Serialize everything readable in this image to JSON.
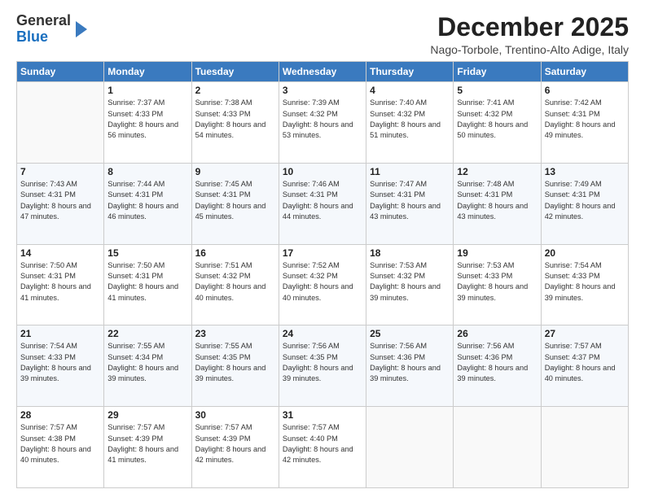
{
  "logo": {
    "general": "General",
    "blue": "Blue"
  },
  "header": {
    "month": "December 2025",
    "location": "Nago-Torbole, Trentino-Alto Adige, Italy"
  },
  "days_of_week": [
    "Sunday",
    "Monday",
    "Tuesday",
    "Wednesday",
    "Thursday",
    "Friday",
    "Saturday"
  ],
  "weeks": [
    [
      {
        "day": "",
        "sunrise": "",
        "sunset": "",
        "daylight": ""
      },
      {
        "day": "1",
        "sunrise": "Sunrise: 7:37 AM",
        "sunset": "Sunset: 4:33 PM",
        "daylight": "Daylight: 8 hours and 56 minutes."
      },
      {
        "day": "2",
        "sunrise": "Sunrise: 7:38 AM",
        "sunset": "Sunset: 4:33 PM",
        "daylight": "Daylight: 8 hours and 54 minutes."
      },
      {
        "day": "3",
        "sunrise": "Sunrise: 7:39 AM",
        "sunset": "Sunset: 4:32 PM",
        "daylight": "Daylight: 8 hours and 53 minutes."
      },
      {
        "day": "4",
        "sunrise": "Sunrise: 7:40 AM",
        "sunset": "Sunset: 4:32 PM",
        "daylight": "Daylight: 8 hours and 51 minutes."
      },
      {
        "day": "5",
        "sunrise": "Sunrise: 7:41 AM",
        "sunset": "Sunset: 4:32 PM",
        "daylight": "Daylight: 8 hours and 50 minutes."
      },
      {
        "day": "6",
        "sunrise": "Sunrise: 7:42 AM",
        "sunset": "Sunset: 4:31 PM",
        "daylight": "Daylight: 8 hours and 49 minutes."
      }
    ],
    [
      {
        "day": "7",
        "sunrise": "Sunrise: 7:43 AM",
        "sunset": "Sunset: 4:31 PM",
        "daylight": "Daylight: 8 hours and 47 minutes."
      },
      {
        "day": "8",
        "sunrise": "Sunrise: 7:44 AM",
        "sunset": "Sunset: 4:31 PM",
        "daylight": "Daylight: 8 hours and 46 minutes."
      },
      {
        "day": "9",
        "sunrise": "Sunrise: 7:45 AM",
        "sunset": "Sunset: 4:31 PM",
        "daylight": "Daylight: 8 hours and 45 minutes."
      },
      {
        "day": "10",
        "sunrise": "Sunrise: 7:46 AM",
        "sunset": "Sunset: 4:31 PM",
        "daylight": "Daylight: 8 hours and 44 minutes."
      },
      {
        "day": "11",
        "sunrise": "Sunrise: 7:47 AM",
        "sunset": "Sunset: 4:31 PM",
        "daylight": "Daylight: 8 hours and 43 minutes."
      },
      {
        "day": "12",
        "sunrise": "Sunrise: 7:48 AM",
        "sunset": "Sunset: 4:31 PM",
        "daylight": "Daylight: 8 hours and 43 minutes."
      },
      {
        "day": "13",
        "sunrise": "Sunrise: 7:49 AM",
        "sunset": "Sunset: 4:31 PM",
        "daylight": "Daylight: 8 hours and 42 minutes."
      }
    ],
    [
      {
        "day": "14",
        "sunrise": "Sunrise: 7:50 AM",
        "sunset": "Sunset: 4:31 PM",
        "daylight": "Daylight: 8 hours and 41 minutes."
      },
      {
        "day": "15",
        "sunrise": "Sunrise: 7:50 AM",
        "sunset": "Sunset: 4:31 PM",
        "daylight": "Daylight: 8 hours and 41 minutes."
      },
      {
        "day": "16",
        "sunrise": "Sunrise: 7:51 AM",
        "sunset": "Sunset: 4:32 PM",
        "daylight": "Daylight: 8 hours and 40 minutes."
      },
      {
        "day": "17",
        "sunrise": "Sunrise: 7:52 AM",
        "sunset": "Sunset: 4:32 PM",
        "daylight": "Daylight: 8 hours and 40 minutes."
      },
      {
        "day": "18",
        "sunrise": "Sunrise: 7:53 AM",
        "sunset": "Sunset: 4:32 PM",
        "daylight": "Daylight: 8 hours and 39 minutes."
      },
      {
        "day": "19",
        "sunrise": "Sunrise: 7:53 AM",
        "sunset": "Sunset: 4:33 PM",
        "daylight": "Daylight: 8 hours and 39 minutes."
      },
      {
        "day": "20",
        "sunrise": "Sunrise: 7:54 AM",
        "sunset": "Sunset: 4:33 PM",
        "daylight": "Daylight: 8 hours and 39 minutes."
      }
    ],
    [
      {
        "day": "21",
        "sunrise": "Sunrise: 7:54 AM",
        "sunset": "Sunset: 4:33 PM",
        "daylight": "Daylight: 8 hours and 39 minutes."
      },
      {
        "day": "22",
        "sunrise": "Sunrise: 7:55 AM",
        "sunset": "Sunset: 4:34 PM",
        "daylight": "Daylight: 8 hours and 39 minutes."
      },
      {
        "day": "23",
        "sunrise": "Sunrise: 7:55 AM",
        "sunset": "Sunset: 4:35 PM",
        "daylight": "Daylight: 8 hours and 39 minutes."
      },
      {
        "day": "24",
        "sunrise": "Sunrise: 7:56 AM",
        "sunset": "Sunset: 4:35 PM",
        "daylight": "Daylight: 8 hours and 39 minutes."
      },
      {
        "day": "25",
        "sunrise": "Sunrise: 7:56 AM",
        "sunset": "Sunset: 4:36 PM",
        "daylight": "Daylight: 8 hours and 39 minutes."
      },
      {
        "day": "26",
        "sunrise": "Sunrise: 7:56 AM",
        "sunset": "Sunset: 4:36 PM",
        "daylight": "Daylight: 8 hours and 39 minutes."
      },
      {
        "day": "27",
        "sunrise": "Sunrise: 7:57 AM",
        "sunset": "Sunset: 4:37 PM",
        "daylight": "Daylight: 8 hours and 40 minutes."
      }
    ],
    [
      {
        "day": "28",
        "sunrise": "Sunrise: 7:57 AM",
        "sunset": "Sunset: 4:38 PM",
        "daylight": "Daylight: 8 hours and 40 minutes."
      },
      {
        "day": "29",
        "sunrise": "Sunrise: 7:57 AM",
        "sunset": "Sunset: 4:39 PM",
        "daylight": "Daylight: 8 hours and 41 minutes."
      },
      {
        "day": "30",
        "sunrise": "Sunrise: 7:57 AM",
        "sunset": "Sunset: 4:39 PM",
        "daylight": "Daylight: 8 hours and 42 minutes."
      },
      {
        "day": "31",
        "sunrise": "Sunrise: 7:57 AM",
        "sunset": "Sunset: 4:40 PM",
        "daylight": "Daylight: 8 hours and 42 minutes."
      },
      {
        "day": "",
        "sunrise": "",
        "sunset": "",
        "daylight": ""
      },
      {
        "day": "",
        "sunrise": "",
        "sunset": "",
        "daylight": ""
      },
      {
        "day": "",
        "sunrise": "",
        "sunset": "",
        "daylight": ""
      }
    ]
  ]
}
